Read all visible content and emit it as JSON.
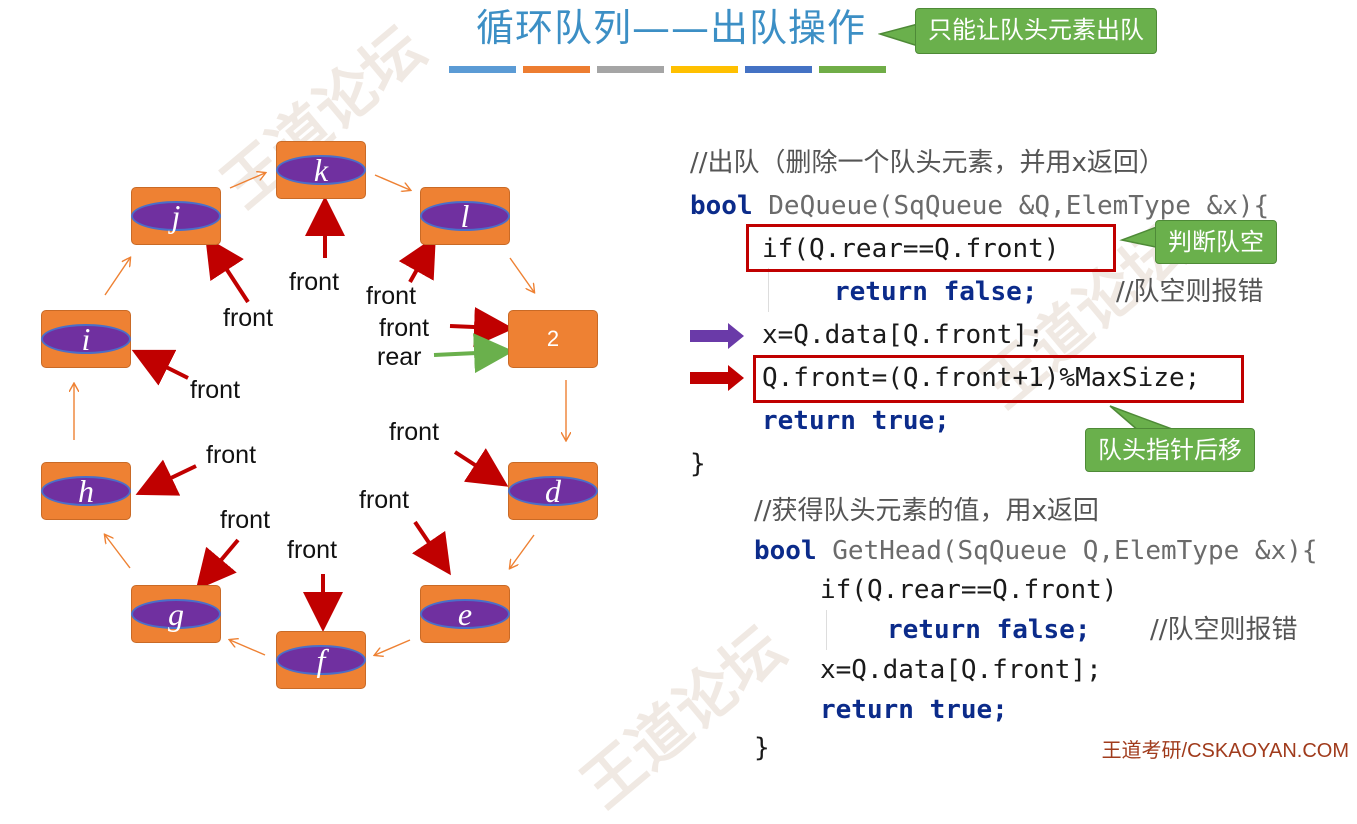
{
  "title": "循环队列——出队操作",
  "title_callout": "只能让队头元素出队",
  "title_bar_colors": [
    "#5b9bd5",
    "#ed7d31",
    "#a5a5a5",
    "#ffc000",
    "#4472c4",
    "#70ad47"
  ],
  "nodes": [
    {
      "id": "k",
      "label": "k"
    },
    {
      "id": "l",
      "label": "l"
    },
    {
      "id": "2",
      "label": "2"
    },
    {
      "id": "d",
      "label": "d"
    },
    {
      "id": "e",
      "label": "e"
    },
    {
      "id": "f",
      "label": "f"
    },
    {
      "id": "g",
      "label": "g"
    },
    {
      "id": "h",
      "label": "h"
    },
    {
      "id": "i",
      "label": "i"
    },
    {
      "id": "j",
      "label": "j"
    }
  ],
  "pointer_labels": {
    "front": "front",
    "rear": "rear"
  },
  "colors": {
    "node_fill": "#ee8133",
    "ellipse_fill": "#7030a0",
    "red_arrow": "#c00000",
    "green_arrow": "#6ab04c",
    "purple_arrow": "#6a3aa8",
    "callout_green": "#6ab04c",
    "title_blue": "#3c8fc5"
  },
  "code1": {
    "comment": "//出队（删除一个队头元素，并用x返回）",
    "line_sig": "bool DeQueue(SqQueue &Q,ElemType &x){",
    "line_if": "if(Q.rear==Q.front)",
    "line_return_false": "return false;",
    "line_return_false_comment": "//队空则报错",
    "line_assign": "x=Q.data[Q.front];",
    "line_move": "Q.front=(Q.front+1)%MaxSize;",
    "line_return_true": "return true;",
    "line_close": "}"
  },
  "callouts": {
    "check_empty": "判断队空",
    "move_pointer": "队头指针后移"
  },
  "code2": {
    "comment": "//获得队头元素的值，用x返回",
    "line_sig": "bool GetHead(SqQueue Q,ElemType &x){",
    "line_if": "if(Q.rear==Q.front)",
    "line_return_false": "return false;",
    "line_return_false_comment": "//队空则报错",
    "line_assign": "x=Q.data[Q.front];",
    "line_return_true": "return true;",
    "line_close": "}"
  },
  "watermark": "王道论坛",
  "footer": "王道考研/CSKAOYAN.COM"
}
